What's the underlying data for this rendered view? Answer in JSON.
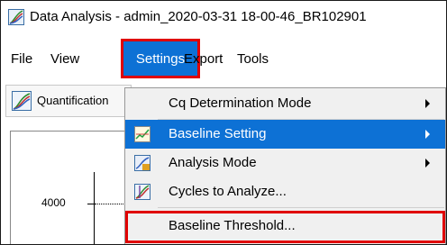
{
  "window": {
    "title": "Data Analysis - admin_2020-03-31 18-00-46_BR102901"
  },
  "menubar": {
    "file": "File",
    "view": "View",
    "settings": "Settings",
    "export": "Export",
    "tools": "Tools"
  },
  "toolbar": {
    "quantification_label": "Quantification"
  },
  "chart": {
    "ytick_4000": "4000"
  },
  "settings_menu": {
    "items": [
      {
        "label": "Cq Determination Mode",
        "icon": "none",
        "submenu": true
      },
      {
        "label": "Baseline Setting",
        "icon": "baseline-icon",
        "submenu": true
      },
      {
        "label": "Analysis Mode",
        "icon": "analysis-mode-icon",
        "submenu": true
      },
      {
        "label": "Cycles to Analyze...",
        "icon": "cycles-icon",
        "submenu": false
      },
      {
        "label": "Baseline Threshold...",
        "icon": "none",
        "submenu": false
      }
    ]
  },
  "colors": {
    "accent": "#0d71d5",
    "highlight_border": "#e00000"
  }
}
